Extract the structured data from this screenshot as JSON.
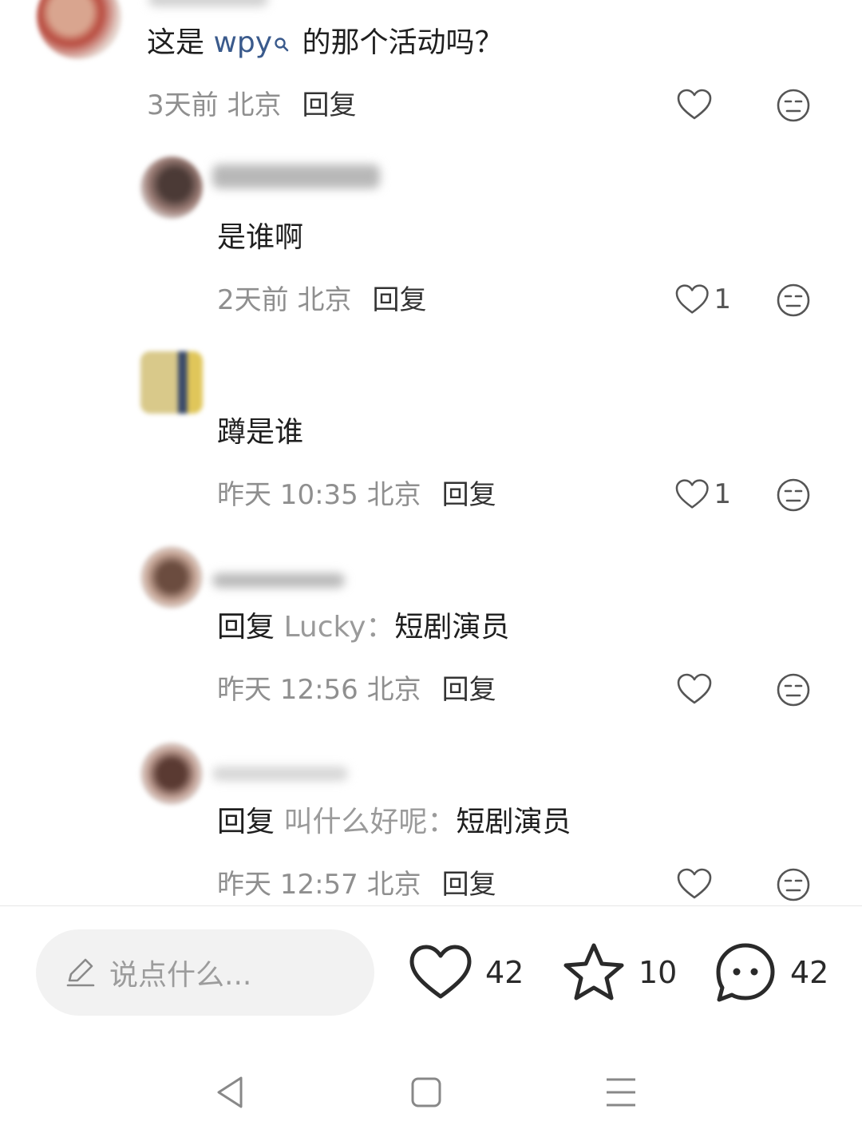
{
  "comments": [
    {
      "text_parts": {
        "a": "这是 ",
        "link": "wpy",
        "b": " 的那个活动吗？"
      },
      "time": "3天前",
      "location": "北京",
      "reply_label": "回复",
      "like_count": ""
    },
    {
      "text": "是谁啊",
      "time": "2天前",
      "location": "北京",
      "reply_label": "回复",
      "like_count": "1"
    },
    {
      "text": "蹲是谁",
      "time": "昨天 10:35",
      "location": "北京",
      "reply_label": "回复",
      "like_count": "1"
    },
    {
      "reply_prefix": "回复",
      "reply_to": "Lucky",
      "colon": "：",
      "text": "短剧演员",
      "time": "昨天 12:56",
      "location": "北京",
      "reply_label": "回复",
      "like_count": ""
    },
    {
      "reply_prefix": "回复",
      "reply_to": "叫什么好呢",
      "colon": "：",
      "text": "短剧演员",
      "time": "昨天 12:57",
      "location": "北京",
      "reply_label": "回复",
      "like_count": ""
    }
  ],
  "bottom_bar": {
    "input_placeholder": "说点什么...",
    "likes": "42",
    "favorites": "10",
    "comments": "42"
  },
  "icons": {
    "like": "heart-icon",
    "dislike": "unamused-face-icon",
    "edit": "pencil-icon",
    "favorite": "star-icon",
    "comment": "chat-bubble-icon",
    "nav_back": "triangle-back-icon",
    "nav_home": "square-home-icon",
    "nav_menu": "menu-lines-icon"
  },
  "colors": {
    "link": "#3a5a8c",
    "muted": "#8f8f8f",
    "input_bg": "#f2f2f2"
  }
}
